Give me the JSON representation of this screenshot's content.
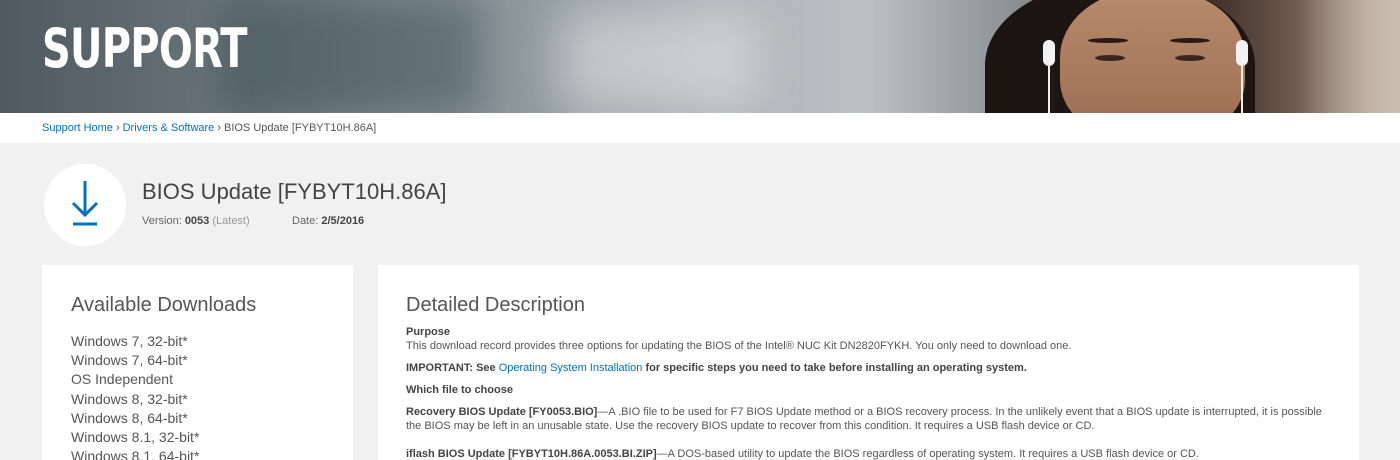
{
  "hero": {
    "title": "SUPPORT"
  },
  "breadcrumb": {
    "items": [
      "Support Home",
      "Drivers & Software",
      "BIOS Update [FYBYT10H.86A]"
    ],
    "separator": "›"
  },
  "header": {
    "title": "BIOS Update [FYBYT10H.86A]",
    "version_label": "Version:",
    "version_value": "0053",
    "version_note": "(Latest)",
    "date_label": "Date:",
    "date_value": "2/5/2016",
    "icon": "download-icon",
    "accent_color": "#0071c5"
  },
  "downloads": {
    "title": "Available Downloads",
    "items": [
      "Windows 7, 32-bit*",
      "Windows 7, 64-bit*",
      "OS Independent",
      "Windows 8, 32-bit*",
      "Windows 8, 64-bit*",
      "Windows 8.1, 32-bit*",
      "Windows 8.1, 64-bit*"
    ]
  },
  "description": {
    "title": "Detailed Description",
    "purpose_heading": "Purpose",
    "purpose_text": "This download record provides three options for updating the BIOS of the Intel® NUC Kit DN2820FYKH. You only need to download one.",
    "important_prefix": "IMPORTANT: See ",
    "important_link": "Operating System Installation",
    "important_suffix": " for specific steps you need to take before installing an operating system.",
    "which_heading": "Which file to choose",
    "recovery_title": "Recovery BIOS Update [FY0053.BIO]",
    "recovery_text": "—A .BIO file to be used for F7 BIOS Update method or a BIOS recovery process. In the unlikely event that a BIOS update is interrupted, it is possible the BIOS may be left in an unusable state. Use the recovery BIOS update to recover from this condition. It requires a USB flash device or CD.",
    "iflash_title": "iflash BIOS Update [FYBYT10H.86A.0053.BI.ZIP]",
    "iflash_text": "—A DOS-based utility to update the BIOS regardless of operating system. It requires a USB flash device or CD."
  }
}
